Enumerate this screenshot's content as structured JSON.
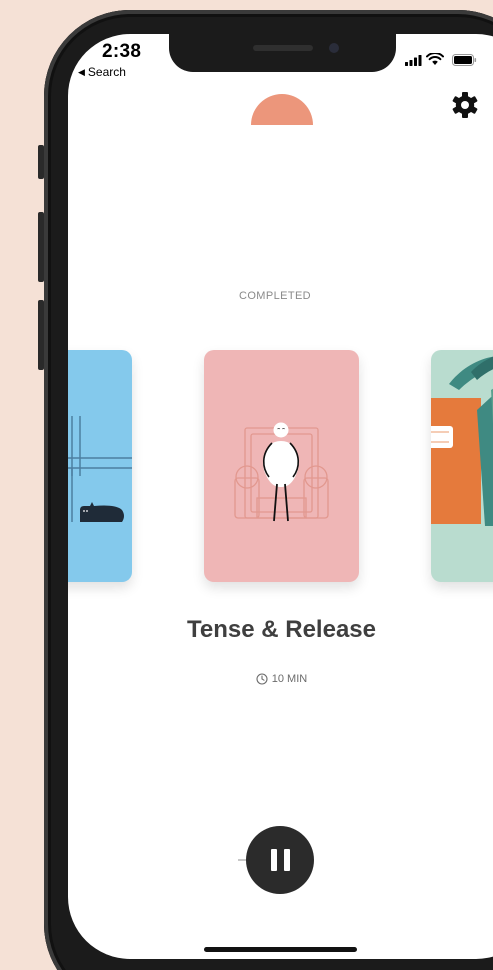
{
  "status_bar": {
    "time": "2:38",
    "back_label": "Search",
    "back_glyph": "◀"
  },
  "player": {
    "status": "COMPLETED",
    "title": "Tense & Release",
    "duration": "10 MIN"
  },
  "colors": {
    "sun": "#ec967b",
    "card_left": "#84c9ec",
    "card_center": "#efb6b6",
    "card_right": "#b9dccf",
    "pause_button": "#2b2b2b"
  },
  "icons": {
    "settings": "gear-icon",
    "timer": "clock-icon",
    "control": "pause-icon"
  }
}
